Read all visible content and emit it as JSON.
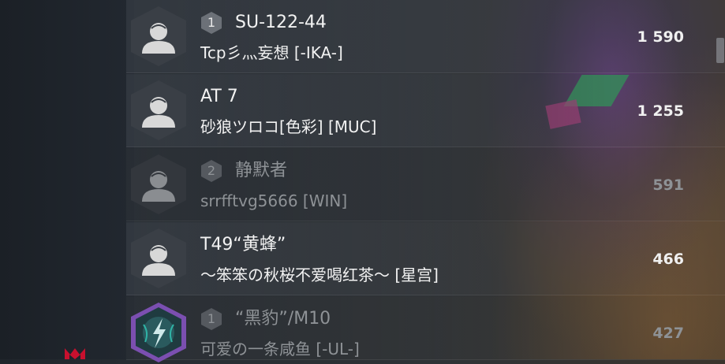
{
  "leaderboard": {
    "rows": [
      {
        "rank": "1",
        "tank": "SU-122-44",
        "player": "Tcp彡灬妄想 [-IKA-]",
        "score": "1 590"
      },
      {
        "rank": "",
        "tank": "AT 7",
        "player": "砂狼ツロコ[色彩] [MUC]",
        "score": "1 255"
      },
      {
        "rank": "2",
        "tank": "静默者",
        "player": "srrfftvg5666 [WIN]",
        "score": "591"
      },
      {
        "rank": "",
        "tank": "T49“黄蜂”",
        "player": "～笨笨の秋桜不爱喝红茶～ [星宫]",
        "score": "466"
      },
      {
        "rank": "1",
        "tank": "“黑豹”/M10",
        "player": "可爱の一条咸鱼 [-UL-]",
        "score": "427"
      }
    ]
  },
  "colors": {
    "accent_red": "#c8102e",
    "emblem_purple": "#7b4fb0",
    "emblem_teal": "#2fb3a6"
  }
}
